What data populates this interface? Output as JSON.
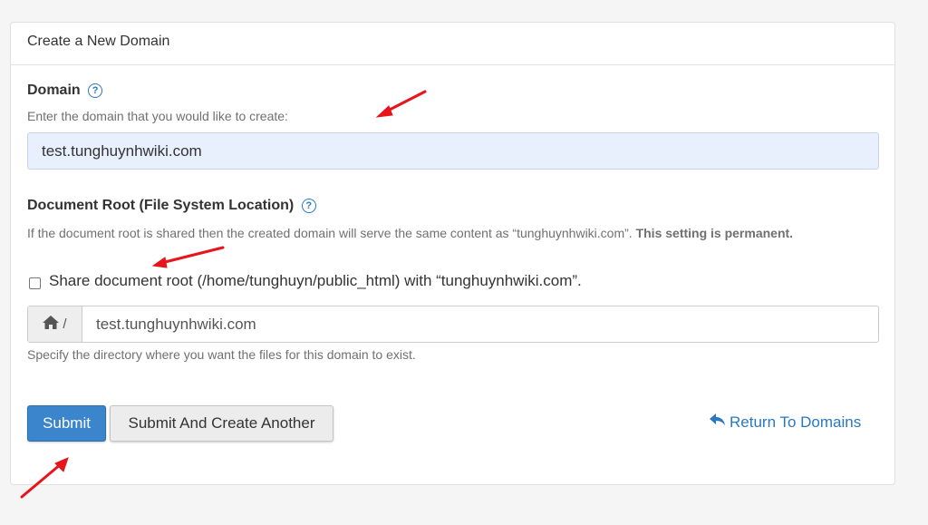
{
  "panel": {
    "title": "Create a New Domain"
  },
  "domain": {
    "label": "Domain",
    "help_icon": "question-circle-icon",
    "help_glyph": "?",
    "hint": "Enter the domain that you would like to create:",
    "value": "test.tunghuynhwiki.com"
  },
  "docroot": {
    "label": "Document Root (File System Location)",
    "help_icon": "question-circle-icon",
    "help_glyph": "?",
    "hint_text": "If the document root is shared then the created domain will serve the same content as “tunghuynhwiki.com”.",
    "hint_bold": "This setting is permanent.",
    "share_checkbox_label": "Share document root (/home/tunghuyn/public_html) with “tunghuynhwiki.com”.",
    "share_checked": false,
    "home_icon": "home-icon",
    "prefix": "/",
    "path_value": "test.tunghuynhwiki.com",
    "path_hint": "Specify the directory where you want the files for this domain to exist."
  },
  "actions": {
    "submit_label": "Submit",
    "submit_another_label": "Submit And Create Another",
    "return_icon": "reply-arrow-icon",
    "return_label": "Return To Domains"
  },
  "colors": {
    "primary": "#3a85cc",
    "link": "#2a78c2",
    "input_autofill_bg": "#e8f0fe",
    "annotation_arrow": "#e8141b"
  }
}
